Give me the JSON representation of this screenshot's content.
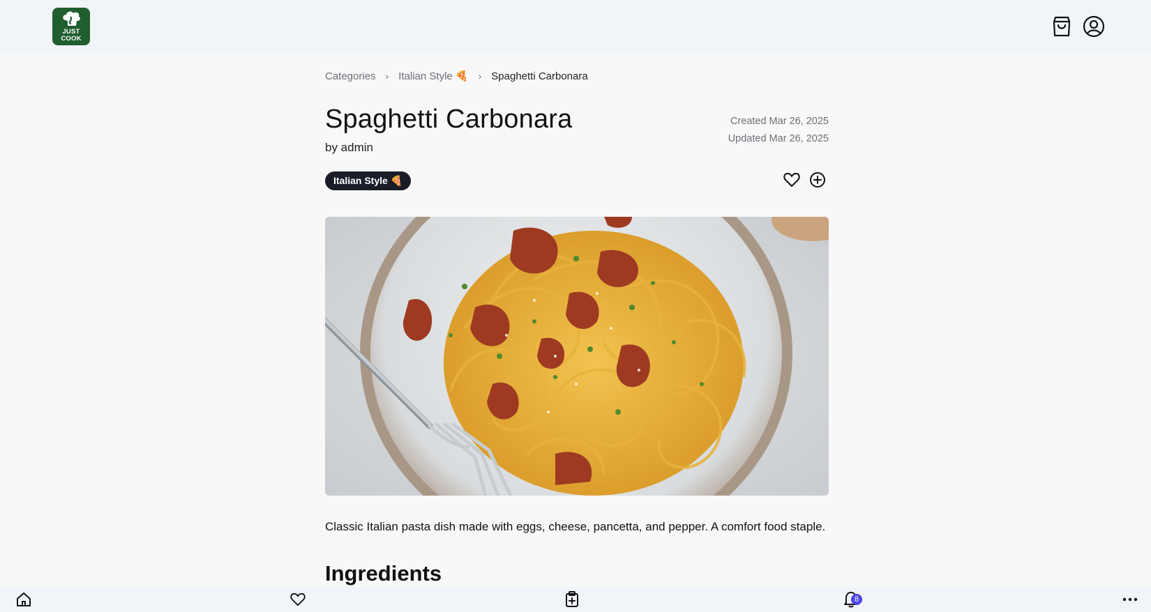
{
  "header": {
    "logo_text_line1": "JUST",
    "logo_text_line2": "COOK",
    "cart_icon": "shopping-bag-icon",
    "user_icon": "user-circle-icon"
  },
  "breadcrumb": {
    "items": [
      "Categories",
      "Italian Style 🍕",
      "Spaghetti Carbonara"
    ]
  },
  "recipe": {
    "title": "Spaghetti Carbonara",
    "author": "by admin",
    "created": "Created Mar 26, 2025",
    "updated": "Updated Mar 26, 2025",
    "tag": "Italian Style 🍕",
    "description": "Classic Italian pasta dish made with eggs, cheese, pancetta, and pepper. A comfort food staple.",
    "ingredients_heading": "Ingredients"
  },
  "bottom_nav": {
    "items": [
      "home-icon",
      "heart-icon",
      "clipboard-plus-icon",
      "bell-icon",
      "more-icon"
    ],
    "notification_count": "8"
  },
  "colors": {
    "brand": "#1f5e2e",
    "tag_bg": "#1a1d27",
    "badge": "#4f46e5",
    "bar_bg": "#f1f4f8"
  }
}
